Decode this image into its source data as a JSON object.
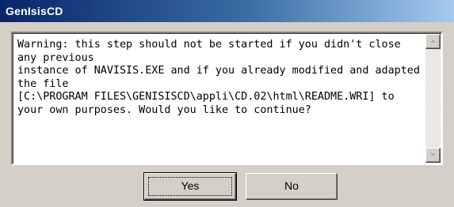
{
  "window": {
    "title": "GenIsisCD"
  },
  "message": {
    "text": "Warning: this step should not be started if you didn't close any previous\ninstance of NAVISIS.EXE and if you already modified and adapted the file\n[C:\\PROGRAM FILES\\GENISISCD\\appli\\CD.02\\html\\README.WRI] to\nyour own purposes. Would you like to continue?"
  },
  "buttons": {
    "yes": "Yes",
    "no": "No"
  },
  "icons": {
    "scroll_up": "scroll-up-arrow-icon",
    "scroll_down": "scroll-down-arrow-icon"
  }
}
